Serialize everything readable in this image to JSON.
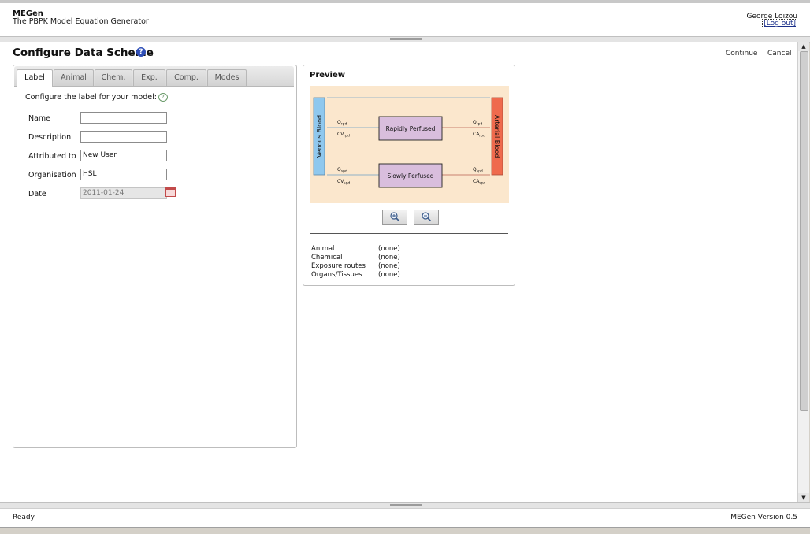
{
  "app": {
    "name": "MEGen",
    "subtitle": "The PBPK Model Equation Generator",
    "user": "George Loizou",
    "logout_label": "[Log out]"
  },
  "page": {
    "title": "Configure Data Scheme",
    "help_icon": "question-circle-icon",
    "continue_label": "Continue",
    "cancel_label": "Cancel"
  },
  "tabs": [
    {
      "label": "Label",
      "active": true
    },
    {
      "label": "Animal",
      "active": false
    },
    {
      "label": "Chem.",
      "active": false
    },
    {
      "label": "Exp.",
      "active": false
    },
    {
      "label": "Comp.",
      "active": false
    },
    {
      "label": "Modes",
      "active": false
    }
  ],
  "form": {
    "intro": "Configure the label for your model:",
    "fields": [
      {
        "label": "Name",
        "value": ""
      },
      {
        "label": "Description",
        "value": ""
      },
      {
        "label": "Attributed to",
        "value": "New User"
      },
      {
        "label": "Organisation",
        "value": "HSL"
      },
      {
        "label": "Date",
        "value": "2011-01-24",
        "disabled": true
      }
    ]
  },
  "preview": {
    "title": "Preview",
    "diagram": {
      "left_block": "Venous Blood",
      "right_block": "Arterial Blood",
      "compartments": [
        "Rapidly Perfused",
        "Slowly Perfused"
      ],
      "flow_labels": {
        "q_rpd": "Q",
        "q_rpd_sub": "rpd",
        "cv_rpd": "CV",
        "cv_rpd_sub": "rpd",
        "q_spd": "Q",
        "q_spd_sub": "spd",
        "cv_spd": "CV",
        "cv_spd_sub": "spd",
        "q_rpd_r": "Q",
        "q_rpd_r_sub": "rpd",
        "ca_rpd": "CA",
        "ca_rpd_sub": "rpd",
        "q_spd_r": "Q",
        "q_spd_r_sub": "spd",
        "ca_spd": "CA",
        "ca_spd_sub": "spd"
      },
      "colors": {
        "background": "#fbe7cd",
        "venous": "#8fc8ee",
        "arterial": "#ef6a4d",
        "compartment": "#d9bedd"
      }
    },
    "zoom_in_icon": "zoom-in-icon",
    "zoom_out_icon": "zoom-out-icon",
    "summary": [
      {
        "key": "Animal",
        "value": "(none)"
      },
      {
        "key": "Chemical",
        "value": "(none)"
      },
      {
        "key": "Exposure routes",
        "value": "(none)"
      },
      {
        "key": "Organs/Tissues",
        "value": "(none)"
      }
    ]
  },
  "status": {
    "left": "Ready",
    "right": "MEGen Version 0.5"
  }
}
